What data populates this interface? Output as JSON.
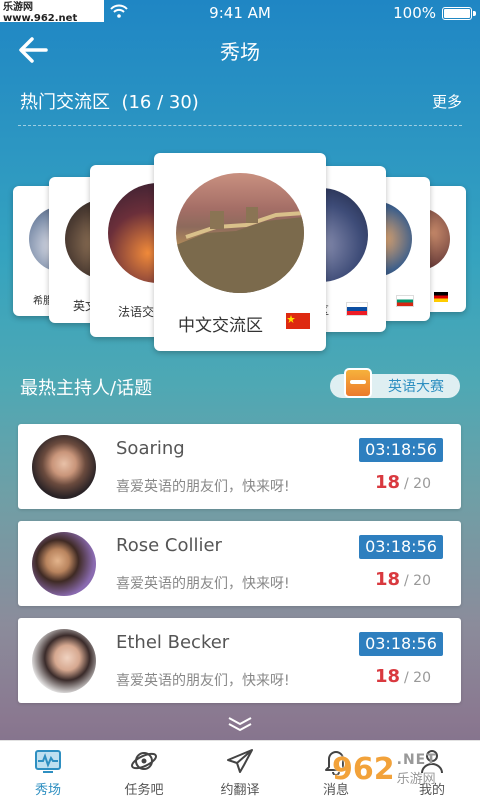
{
  "watermark": {
    "top_text": "乐游网 www.962.net",
    "logo_num": "962",
    "logo_net": ".NET",
    "logo_cn": "乐游网"
  },
  "status_bar": {
    "time": "9:41 AM",
    "battery": "100%"
  },
  "nav": {
    "title": "秀场",
    "back_icon": "arrow-left-icon"
  },
  "hot_zone": {
    "label": "热门交流区",
    "count": "(16 / 30)",
    "more": "更多",
    "cards": [
      {
        "name": "希腊",
        "flag": "greece-flag"
      },
      {
        "name": "英文",
        "flag": "uk-flag"
      },
      {
        "name": "法语交",
        "flag": "france-flag"
      },
      {
        "name": "中文交流区",
        "flag": "china-flag"
      },
      {
        "name": "区",
        "flag": "slovakia-flag"
      },
      {
        "name": "",
        "flag": "bulgaria-flag"
      },
      {
        "name": "",
        "flag": "germany-flag"
      }
    ]
  },
  "topics": {
    "label": "最热主持人/话题",
    "contest_label": "英语大赛",
    "hosts": [
      {
        "name": "Soaring",
        "desc": "喜爱英语的朋友们，快来呀!",
        "timer": "03:18:56",
        "current": "18",
        "total": "/ 20"
      },
      {
        "name": "Rose Collier",
        "desc": "喜爱英语的朋友们，快来呀!",
        "timer": "03:18:56",
        "current": "18",
        "total": "/ 20"
      },
      {
        "name": "Ethel Becker",
        "desc": "喜爱英语的朋友们，快来呀!",
        "timer": "03:18:56",
        "current": "18",
        "total": "/ 20"
      }
    ]
  },
  "tabbar": {
    "tabs": [
      {
        "label": "秀场",
        "icon": "showcase-icon",
        "active": true
      },
      {
        "label": "任务吧",
        "icon": "planet-icon",
        "active": false
      },
      {
        "label": "约翻译",
        "icon": "paper-plane-icon",
        "active": false
      },
      {
        "label": "消息",
        "icon": "bell-icon",
        "active": false
      },
      {
        "label": "我的",
        "icon": "person-icon",
        "active": false
      }
    ]
  },
  "colors": {
    "accent": "#2e8fc1",
    "timer_bg": "#2e7fbf",
    "count_red": "#d9393f"
  }
}
